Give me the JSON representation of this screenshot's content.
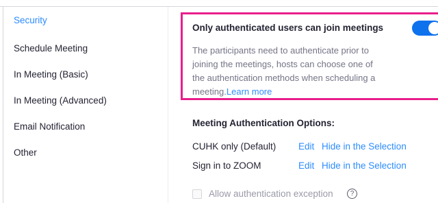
{
  "sidebar": {
    "items": [
      {
        "label": "Security"
      },
      {
        "label": "Schedule Meeting"
      },
      {
        "label": "In Meeting (Basic)"
      },
      {
        "label": "In Meeting (Advanced)"
      },
      {
        "label": "Email Notification"
      },
      {
        "label": "Other"
      }
    ],
    "active_index": 0
  },
  "setting": {
    "title": "Only authenticated users can join meetings",
    "description_lines": [
      "The participants need to authenticate prior to",
      "joining the meetings, hosts can choose one of",
      "the authentication methods when scheduling a",
      "meeting."
    ],
    "learn_more_label": "Learn more",
    "toggle_state": "on"
  },
  "options": {
    "heading": "Meeting Authentication Options:",
    "rows": [
      {
        "name": "CUHK only (Default)",
        "edit_label": "Edit",
        "hide_label": "Hide in the Selection"
      },
      {
        "name": "Sign in to ZOOM",
        "edit_label": "Edit",
        "hide_label": "Hide in the Selection"
      }
    ]
  },
  "exception": {
    "label": "Allow authentication exception",
    "checked": false,
    "help_icon": "question-circle-icon",
    "help_glyph": "?"
  },
  "colors": {
    "accent": "#2d8cff",
    "toggle_on": "#0e72ed",
    "highlight": "#e91e8c"
  }
}
